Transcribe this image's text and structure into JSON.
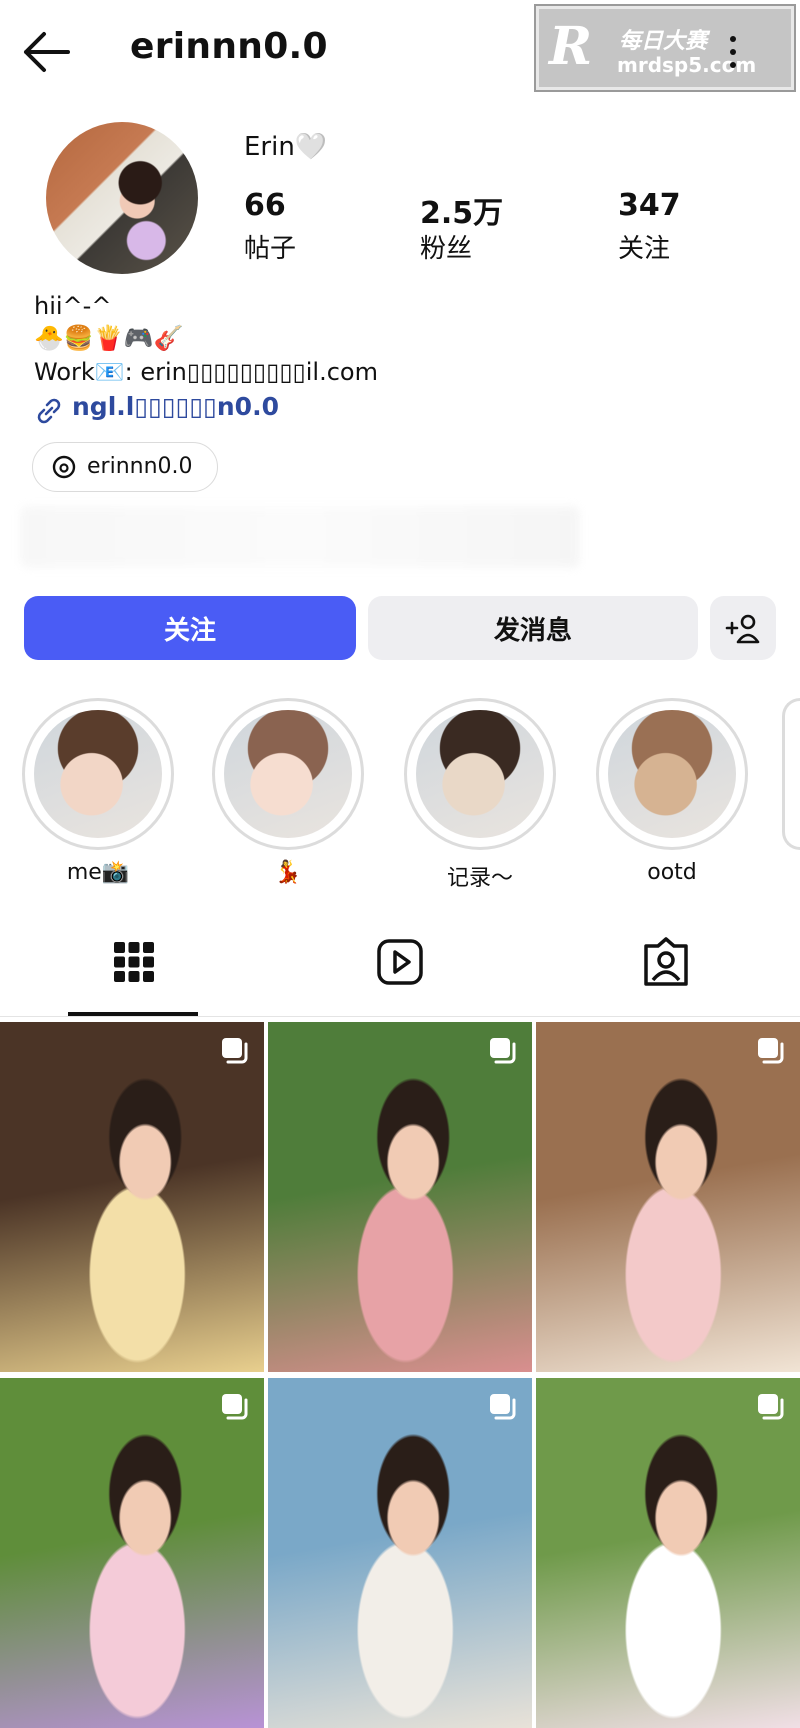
{
  "header": {
    "username": "erinnn0.0",
    "watermark_logo": "R",
    "watermark_cn": "每日大赛",
    "watermark_url": "mrdsp5.com"
  },
  "profile": {
    "display_name": "Erin🤍",
    "stats": [
      {
        "value": "66",
        "label": "帖子"
      },
      {
        "value": "2.5万",
        "label": "粉丝"
      },
      {
        "value": "347",
        "label": "关注"
      }
    ]
  },
  "bio": {
    "line1": "hii^-^",
    "line2": "🐣🍔🍟🎮🎸",
    "line3": "Work📧: erin▯▯▯▯▯▯▯▯▯il.com",
    "link": "ngl.l▯▯▯▯▯▯n0.0",
    "threads_handle": "erinnn0.0"
  },
  "actions": {
    "follow": "关注",
    "message": "发消息"
  },
  "highlights": [
    {
      "label": "me📸",
      "color_a": "#f2d6c6",
      "color_b": "#5a3d2c"
    },
    {
      "label": "💃",
      "color_a": "#f6ddd0",
      "color_b": "#8a6350"
    },
    {
      "label": "记录～",
      "color_a": "#e9d8c7",
      "color_b": "#3a2a22"
    },
    {
      "label": "ootd",
      "color_a": "#d6b392",
      "color_b": "#9a7054"
    }
  ],
  "tabs": [
    "posts-grid-icon",
    "reels-icon",
    "tagged-icon"
  ],
  "posts": [
    {
      "bg_a": "#4b3426",
      "bg_b": "#e8cf8e",
      "accent": "#f3dfa8"
    },
    {
      "bg_a": "#4f7d3a",
      "bg_b": "#d98f8f",
      "accent": "#e7a2a6"
    },
    {
      "bg_a": "#9a7050",
      "bg_b": "#f1e4d5",
      "accent": "#f3c9c9"
    },
    {
      "bg_a": "#5f8e3a",
      "bg_b": "#b892d6",
      "accent": "#f4cbd8"
    },
    {
      "bg_a": "#7aa8c8",
      "bg_b": "#e8e2d8",
      "accent": "#f2eee8"
    },
    {
      "bg_a": "#6f9a4a",
      "bg_b": "#f1dfe6",
      "accent": "#ffffff"
    }
  ],
  "colors": {
    "accent_blue": "#4a5cf5",
    "link_blue": "#2e4a9e",
    "button_gray": "#eeeef1"
  }
}
